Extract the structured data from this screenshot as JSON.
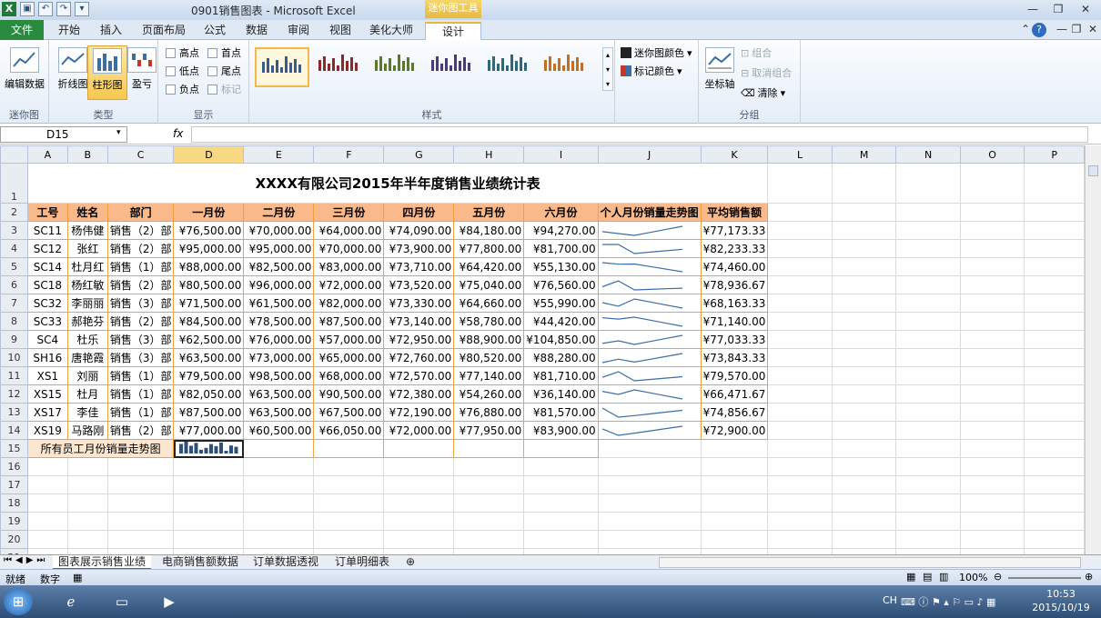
{
  "window": {
    "title": "0901销售图表 - Microsoft Excel",
    "context_tab_title": "迷你图工具"
  },
  "tabs": [
    "开始",
    "插入",
    "页面布局",
    "公式",
    "数据",
    "审阅",
    "视图",
    "美化大师",
    "设计"
  ],
  "file_tab": "文件",
  "ribbon": {
    "groups": {
      "sparkline": "迷你图",
      "type": "类型",
      "show": "显示",
      "style": "样式",
      "group": "分组"
    },
    "edit_data": "编辑数据",
    "type_buttons": [
      "折线图",
      "柱形图",
      "盈亏"
    ],
    "show_checks": {
      "left": [
        "高点",
        "低点",
        "负点"
      ],
      "right": [
        "首点",
        "尾点",
        "标记"
      ]
    },
    "sparkline_color": "迷你图颜色",
    "marker_color": "标记颜色",
    "axis": "坐标轴",
    "group_btn": "组合",
    "ungroup_btn": "取消组合",
    "clear_btn": "清除"
  },
  "namebox": "D15",
  "fx": "fx",
  "columns": [
    "A",
    "B",
    "C",
    "D",
    "E",
    "F",
    "G",
    "H",
    "I",
    "J",
    "K",
    "L",
    "M",
    "N",
    "O",
    "P"
  ],
  "sheet": {
    "title": "XXXX有限公司2015年半年度销售业绩统计表",
    "headers": [
      "工号",
      "姓名",
      "部门",
      "一月份",
      "二月份",
      "三月份",
      "四月份",
      "五月份",
      "六月份",
      "个人月份销量走势图",
      "平均销售额"
    ],
    "rows": [
      [
        "SC11",
        "杨伟健",
        "销售（2）部",
        "¥76,500.00",
        "¥70,000.00",
        "¥64,000.00",
        "¥74,090.00",
        "¥84,180.00",
        "¥94,270.00",
        "¥77,173.33"
      ],
      [
        "SC12",
        "张红",
        "销售（2）部",
        "¥95,000.00",
        "¥95,000.00",
        "¥70,000.00",
        "¥73,900.00",
        "¥77,800.00",
        "¥81,700.00",
        "¥82,233.33"
      ],
      [
        "SC14",
        "杜月红",
        "销售（1）部",
        "¥88,000.00",
        "¥82,500.00",
        "¥83,000.00",
        "¥73,710.00",
        "¥64,420.00",
        "¥55,130.00",
        "¥74,460.00"
      ],
      [
        "SC18",
        "杨红敏",
        "销售（2）部",
        "¥80,500.00",
        "¥96,000.00",
        "¥72,000.00",
        "¥73,520.00",
        "¥75,040.00",
        "¥76,560.00",
        "¥78,936.67"
      ],
      [
        "SC32",
        "李丽丽",
        "销售（3）部",
        "¥71,500.00",
        "¥61,500.00",
        "¥82,000.00",
        "¥73,330.00",
        "¥64,660.00",
        "¥55,990.00",
        "¥68,163.33"
      ],
      [
        "SC33",
        "郝艳芬",
        "销售（2）部",
        "¥84,500.00",
        "¥78,500.00",
        "¥87,500.00",
        "¥73,140.00",
        "¥58,780.00",
        "¥44,420.00",
        "¥71,140.00"
      ],
      [
        "SC4",
        "杜乐",
        "销售（3）部",
        "¥62,500.00",
        "¥76,000.00",
        "¥57,000.00",
        "¥72,950.00",
        "¥88,900.00",
        "¥104,850.00",
        "¥77,033.33"
      ],
      [
        "SH16",
        "唐艳霞",
        "销售（3）部",
        "¥63,500.00",
        "¥73,000.00",
        "¥65,000.00",
        "¥72,760.00",
        "¥80,520.00",
        "¥88,280.00",
        "¥73,843.33"
      ],
      [
        "XS1",
        "刘丽",
        "销售（1）部",
        "¥79,500.00",
        "¥98,500.00",
        "¥68,000.00",
        "¥72,570.00",
        "¥77,140.00",
        "¥81,710.00",
        "¥79,570.00"
      ],
      [
        "XS15",
        "杜月",
        "销售（1）部",
        "¥82,050.00",
        "¥63,500.00",
        "¥90,500.00",
        "¥72,380.00",
        "¥54,260.00",
        "¥36,140.00",
        "¥66,471.67"
      ],
      [
        "XS17",
        "李佳",
        "销售（1）部",
        "¥87,500.00",
        "¥63,500.00",
        "¥67,500.00",
        "¥72,190.00",
        "¥76,880.00",
        "¥81,570.00",
        "¥74,856.67"
      ],
      [
        "XS19",
        "马路刚",
        "销售（2）部",
        "¥77,000.00",
        "¥60,500.00",
        "¥66,050.00",
        "¥72,000.00",
        "¥77,950.00",
        "¥83,900.00",
        "¥72,900.00"
      ]
    ],
    "sparkline_values": [
      [
        76500,
        70000,
        64000,
        74090,
        84180,
        94270
      ],
      [
        95000,
        95000,
        70000,
        73900,
        77800,
        81700
      ],
      [
        88000,
        82500,
        83000,
        73710,
        64420,
        55130
      ],
      [
        80500,
        96000,
        72000,
        73520,
        75040,
        76560
      ],
      [
        71500,
        61500,
        82000,
        73330,
        64660,
        55990
      ],
      [
        84500,
        78500,
        87500,
        73140,
        58780,
        44420
      ],
      [
        62500,
        76000,
        57000,
        72950,
        88900,
        104850
      ],
      [
        63500,
        73000,
        65000,
        72760,
        80520,
        88280
      ],
      [
        79500,
        98500,
        68000,
        72570,
        77140,
        81710
      ],
      [
        82050,
        63500,
        90500,
        72380,
        54260,
        36140
      ],
      [
        87500,
        63500,
        67500,
        72190,
        76880,
        81570
      ],
      [
        77000,
        60500,
        66050,
        72000,
        77950,
        83900
      ]
    ],
    "row15_label": "所有员工月份销量走势图",
    "column_sparkline": [
      77173,
      82233,
      74460,
      78937,
      68163,
      71140,
      77033,
      73843,
      79570,
      66472,
      74857,
      72900
    ]
  },
  "sheet_tabs": [
    "图表展示销售业绩",
    "电商销售额数据",
    "订单数据透视",
    "订单明细表"
  ],
  "status": {
    "ready": "就绪",
    "mode": "数字",
    "zoom": "100%"
  },
  "taskbar": {
    "lang": "CH",
    "time": "10:53",
    "date": "2015/10/19"
  },
  "colors": {
    "accent": "#2a8a3f",
    "header_fill": "#f9b98a",
    "border": "#f0a040",
    "spark": "#3a6ea5",
    "context": "#e8b83d"
  }
}
